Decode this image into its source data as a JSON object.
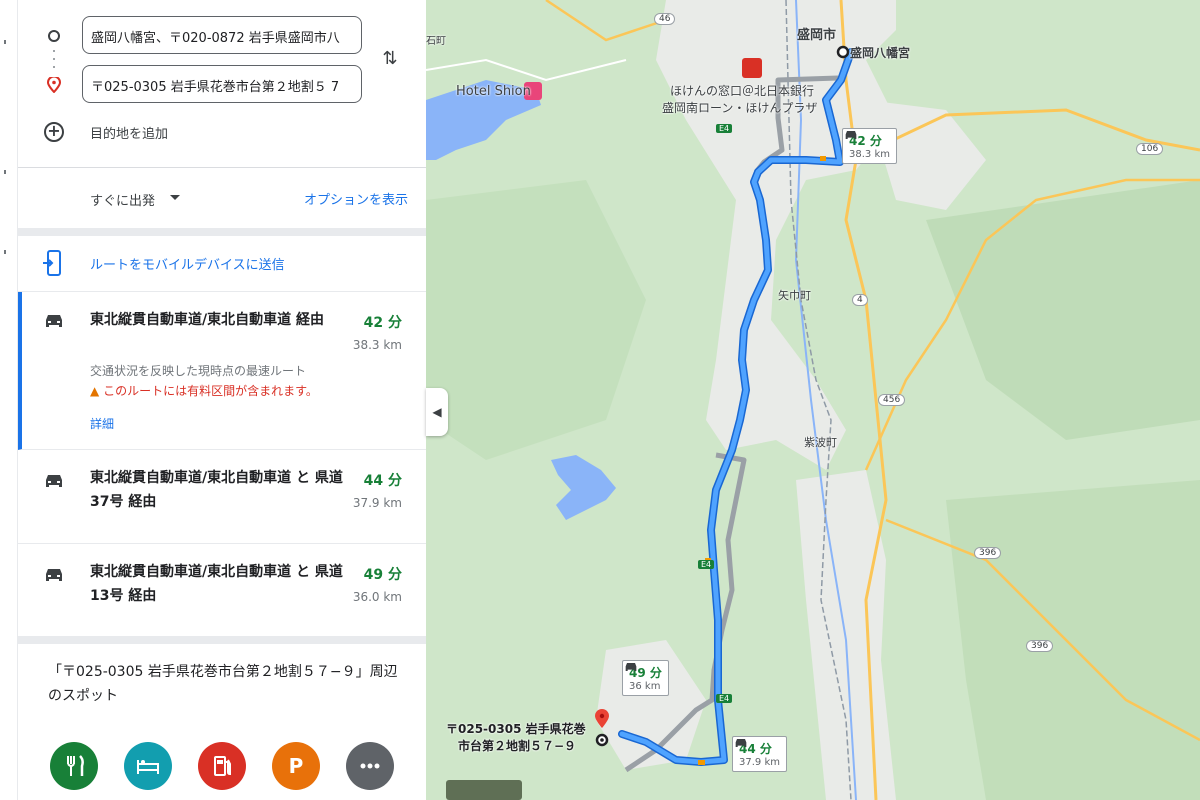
{
  "origin": {
    "value": "盛岡八幡宮、〒020-0872 岩手県盛岡市八"
  },
  "destination": {
    "value": "〒025-0305 岩手県花巻市台第２地割５ 7"
  },
  "add_destination": "目的地を追加",
  "depart": {
    "label": "すぐに出発",
    "options_link": "オプションを表示"
  },
  "send_to_mobile": "ルートをモバイルデバイスに送信",
  "routes": [
    {
      "name": "東北縦貫自動車道/東北自動車道 経由",
      "time": "42 分",
      "distance": "38.3 km",
      "subtitle": "交通状況を反映した現時点の最速ルート",
      "warning": "このルートには有料区間が含まれます。",
      "details": "詳細",
      "selected": true
    },
    {
      "name": "東北縦貫自動車道/東北自動車道 と 県道37号 経由",
      "time": "44 分",
      "distance": "37.9 km",
      "selected": false
    },
    {
      "name": "東北縦貫自動車道/東北自動車道 と 県道13号 経由",
      "time": "49 分",
      "distance": "36.0 km",
      "selected": false
    }
  ],
  "nearby": {
    "title": "「〒025-0305 岩手県花巻市台第２地割５７−９」周辺のスポット",
    "categories": [
      {
        "name": "restaurant",
        "icon": "fork-knife-icon",
        "color": "#188038"
      },
      {
        "name": "hotel",
        "icon": "bed-icon",
        "color": "#129eaf"
      },
      {
        "name": "gas",
        "icon": "gas-pump-icon",
        "color": "#d93025"
      },
      {
        "name": "parking",
        "icon": "P",
        "color": "#e8710a"
      },
      {
        "name": "more",
        "icon": "more-icon",
        "color": "#5f6368"
      }
    ]
  },
  "map": {
    "labels": {
      "morioka_city": "盛岡市",
      "hachimangu": "盛岡八幡宮",
      "hoken": "ほけんの窓口＠北日本銀行",
      "hoken2": "盛岡南ローン・ほけんプラザ",
      "hotel": "Hotel Shion",
      "yahaba": "矢巾町",
      "shiwa": "紫波町",
      "dest": "〒025-0305 岩手県花巻",
      "dest2": "市台第２地割５７−９",
      "ishi": "石町"
    },
    "bubbles": [
      {
        "time": "42 分",
        "distance": "38.3 km"
      },
      {
        "time": "49 分",
        "distance": "36 km"
      },
      {
        "time": "44 分",
        "distance": "37.9 km"
      }
    ],
    "road_badges": [
      "46",
      "106",
      "4",
      "456",
      "396",
      "396",
      "E4",
      "E4",
      "E4"
    ],
    "colors": {
      "route": "#1a73e8",
      "alt": "#9aa0a6",
      "park": "#cfe6c9",
      "urban": "#ececec",
      "water": "#8ab4f8"
    }
  }
}
